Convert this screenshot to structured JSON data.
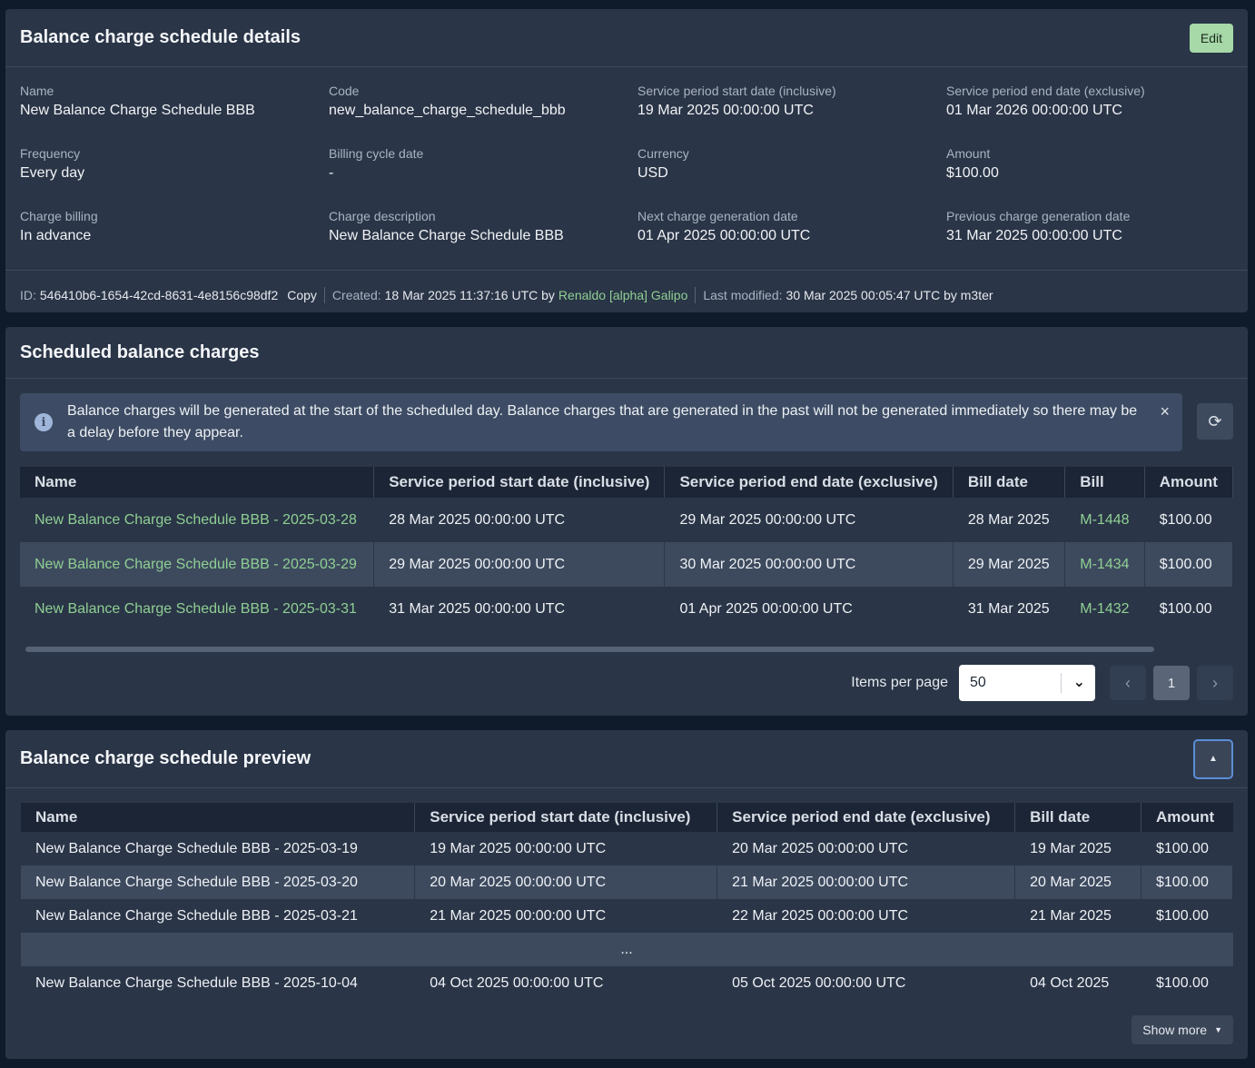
{
  "details": {
    "title": "Balance charge schedule details",
    "edit_label": "Edit",
    "fields": [
      {
        "label": "Name",
        "value": "New Balance Charge Schedule BBB"
      },
      {
        "label": "Code",
        "value": "new_balance_charge_schedule_bbb"
      },
      {
        "label": "Service period start date (inclusive)",
        "value": "19 Mar 2025 00:00:00 UTC"
      },
      {
        "label": "Service period end date (exclusive)",
        "value": "01 Mar 2026 00:00:00 UTC"
      },
      {
        "label": "Frequency",
        "value": "Every day"
      },
      {
        "label": "Billing cycle date",
        "value": "-"
      },
      {
        "label": "Currency",
        "value": "USD"
      },
      {
        "label": "Amount",
        "value": "$100.00"
      },
      {
        "label": "Charge billing",
        "value": "In advance"
      },
      {
        "label": "Charge description",
        "value": "New Balance Charge Schedule BBB"
      },
      {
        "label": "Next charge generation date",
        "value": "01 Apr 2025 00:00:00 UTC"
      },
      {
        "label": "Previous charge generation date",
        "value": "31 Mar 2025 00:00:00 UTC"
      }
    ],
    "meta": {
      "id_label": "ID:",
      "id_value": "546410b6-1654-42cd-8631-4e8156c98df2",
      "copy_label": "Copy",
      "created_label": "Created:",
      "created_value": "18 Mar 2025 11:37:16 UTC by",
      "created_by": "Renaldo [alpha] Galipo",
      "modified_label": "Last modified:",
      "modified_value": "30 Mar 2025 00:05:47 UTC by m3ter"
    }
  },
  "charges": {
    "title": "Scheduled balance charges",
    "banner_text": "Balance charges will be generated at the start of the scheduled day. Balance charges that are generated in the past will not be generated immediately so there may be a delay before they appear.",
    "close_icon": "×",
    "refresh_icon": "⟳",
    "columns": [
      "Name",
      "Service period start date (inclusive)",
      "Service period end date (exclusive)",
      "Bill date",
      "Bill",
      "Amount"
    ],
    "rows": [
      [
        "New Balance Charge Schedule BBB - 2025-03-28",
        "28 Mar 2025 00:00:00 UTC",
        "29 Mar 2025 00:00:00 UTC",
        "28 Mar 2025",
        "M-1448",
        "$100.00"
      ],
      [
        "New Balance Charge Schedule BBB - 2025-03-29",
        "29 Mar 2025 00:00:00 UTC",
        "30 Mar 2025 00:00:00 UTC",
        "29 Mar 2025",
        "M-1434",
        "$100.00"
      ],
      [
        "New Balance Charge Schedule BBB - 2025-03-31",
        "31 Mar 2025 00:00:00 UTC",
        "01 Apr 2025 00:00:00 UTC",
        "31 Mar 2025",
        "M-1432",
        "$100.00"
      ]
    ],
    "pager": {
      "items_label": "Items per page",
      "items_value": "50",
      "page": "1",
      "prev_icon": "‹",
      "next_icon": "›",
      "chevron_icon": "⌄"
    }
  },
  "preview": {
    "title": "Balance charge schedule preview",
    "collapse_icon": "▲",
    "columns": [
      "Name",
      "Service period start date (inclusive)",
      "Service period end date (exclusive)",
      "Bill date",
      "Amount"
    ],
    "rows": [
      [
        "New Balance Charge Schedule BBB - 2025-03-19",
        "19 Mar 2025 00:00:00 UTC",
        "20 Mar 2025 00:00:00 UTC",
        "19 Mar 2025",
        "$100.00"
      ],
      [
        "New Balance Charge Schedule BBB - 2025-03-20",
        "20 Mar 2025 00:00:00 UTC",
        "21 Mar 2025 00:00:00 UTC",
        "20 Mar 2025",
        "$100.00"
      ],
      [
        "New Balance Charge Schedule BBB - 2025-03-21",
        "21 Mar 2025 00:00:00 UTC",
        "22 Mar 2025 00:00:00 UTC",
        "21 Mar 2025",
        "$100.00"
      ]
    ],
    "ellipsis": "...",
    "last_row": [
      "New Balance Charge Schedule BBB - 2025-10-04",
      "04 Oct 2025 00:00:00 UTC",
      "05 Oct 2025 00:00:00 UTC",
      "04 Oct 2025",
      "$100.00"
    ],
    "show_more_label": "Show more",
    "show_more_icon": "▼"
  }
}
